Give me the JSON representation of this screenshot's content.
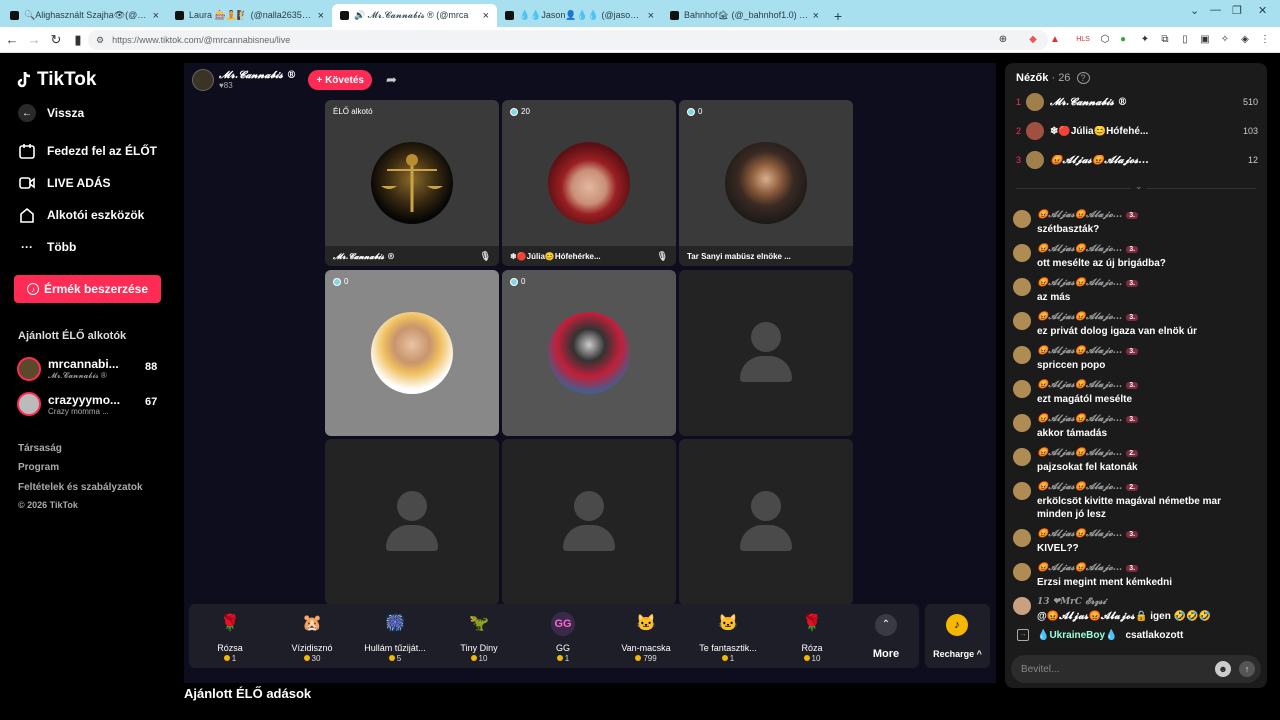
{
  "browser": {
    "tabs": [
      {
        "label": "🔍Alighasznált Szajha👁(@feherfa"
      },
      {
        "label": "Laura 🎰🧘🧗 (@nalla2635) ÉLŐ adá"
      },
      {
        "label": "🔊 𝓜𝓻.𝓒𝓪𝓷𝓷𝓪𝓫𝓲𝓼 ® (@mrca",
        "active": true
      },
      {
        "label": "💧💧Jason👤💧💧 (@jason_samara"
      },
      {
        "label": "Bahnhof🏚 (@_bahnhof1.0) ÉLŐ adá"
      }
    ],
    "new_tab": "+",
    "url": "https://www.tiktok.com/@mrcannabisneu/live"
  },
  "sidebar": {
    "logo": "TikTok",
    "nav": [
      {
        "label": "Vissza",
        "icon": "arrow-left-icon"
      },
      {
        "label": "Fedezd fel az ÉLŐT",
        "icon": "calendar-icon"
      },
      {
        "label": "LIVE ADÁS",
        "icon": "camera-icon"
      },
      {
        "label": "Alkotói eszközök",
        "icon": "home-icon"
      },
      {
        "label": "Több",
        "icon": "more-dots-icon"
      }
    ],
    "buy_button": "Érmék beszerzése",
    "recommended_title": "Ajánlott ÉLŐ alkotók",
    "recommended": [
      {
        "name": "mrcannabi...",
        "sub": "𝓜𝓻.𝓒𝓪𝓷𝓷𝓪𝓫𝓲𝓼 ®",
        "count": "88"
      },
      {
        "name": "crazyyymo...",
        "sub": "Crazy momma ...",
        "count": "67"
      }
    ],
    "footer": [
      "Társaság",
      "Program",
      "Feltételek és szabályzatok",
      "© 2026 TikTok"
    ]
  },
  "stream": {
    "host_name": "𝓜𝓻.𝓒𝓪𝓷𝓷𝓪𝓫𝓲𝓼 ®",
    "likes": "♥83",
    "follow": "+ Követés",
    "tiles": [
      {
        "top": "ÉLŐ alkotó",
        "caption": "𝓜𝓻.𝓒𝓪𝓷𝓷𝓪𝓫𝓲𝓼 ®"
      },
      {
        "top": "20",
        "caption": "❄🔴Júlia😊Hófehérke..."
      },
      {
        "top": "0",
        "caption": "Tar Sanyi mabüsz elnöke ..."
      },
      {
        "top": "0",
        "caption": ""
      },
      {
        "top": "0",
        "caption": ""
      }
    ]
  },
  "gifts": [
    {
      "name": "Rózsa",
      "price": "1",
      "icon": "🌹"
    },
    {
      "name": "Vízidisznó",
      "price": "30",
      "icon": "🐹"
    },
    {
      "name": "Hullám tűziját...",
      "price": "5",
      "icon": "🎆"
    },
    {
      "name": "Tiny Diny",
      "price": "10",
      "icon": "🦖"
    },
    {
      "name": "GG",
      "price": "1",
      "icon": "GG"
    },
    {
      "name": "Van-macska",
      "price": "799",
      "icon": "🐱"
    },
    {
      "name": "Te fantasztik...",
      "price": "1",
      "icon": "🐱"
    },
    {
      "name": "Róza",
      "price": "10",
      "icon": "🌹"
    }
  ],
  "more_label": "More",
  "recharge_label": "Recharge ^",
  "suggested_title": "Ajánlott ÉLŐ adások",
  "chat": {
    "title": "Nézők",
    "viewer_count": "· 26",
    "top_viewers": [
      {
        "rank": "1",
        "name": "𝓜𝓻.𝓒𝓪𝓷𝓷𝓪𝓫𝓲𝓼 ®",
        "score": "510"
      },
      {
        "rank": "2",
        "name": "❄🔴Júlia😊Hófehé...",
        "score": "103"
      },
      {
        "rank": "3",
        "name": "😡𝓐𝓵𝓳𝓪𝓼😡𝓐𝓵𝓪𝓳𝓸𝓼...",
        "score": "12"
      }
    ],
    "messages": [
      {
        "user": "😡𝓐𝓵𝓳𝓪𝓼😡𝓐𝓵𝓪𝓳𝓸...",
        "badge": "3.",
        "text": "szétbaszták?"
      },
      {
        "user": "😡𝓐𝓵𝓳𝓪𝓼😡𝓐𝓵𝓪𝓳𝓸...",
        "badge": "3.",
        "text": "ott mesélte az új brigádba?"
      },
      {
        "user": "😡𝓐𝓵𝓳𝓪𝓼😡𝓐𝓵𝓪𝓳𝓸...",
        "badge": "3.",
        "text": "az más"
      },
      {
        "user": "😡𝓐𝓵𝓳𝓪𝓼😡𝓐𝓵𝓪𝓳𝓸...",
        "badge": "3.",
        "text": "ez privát dolog igaza van elnök úr"
      },
      {
        "user": "😡𝓐𝓵𝓳𝓪𝓼😡𝓐𝓵𝓪𝓳𝓸...",
        "badge": "3.",
        "text": "spriccen popo"
      },
      {
        "user": "😡𝓐𝓵𝓳𝓪𝓼😡𝓐𝓵𝓪𝓳𝓸...",
        "badge": "3.",
        "text": "ezt magától mesélte"
      },
      {
        "user": "😡𝓐𝓵𝓳𝓪𝓼😡𝓐𝓵𝓪𝓳𝓸...",
        "badge": "3.",
        "text": "akkor támadás"
      },
      {
        "user": "😡𝓐𝓵𝓳𝓪𝓼😡𝓐𝓵𝓪𝓳𝓸...",
        "badge": "2.",
        "text": "pajzsokat fel katonák"
      },
      {
        "user": "😡𝓐𝓵𝓳𝓪𝓼😡𝓐𝓵𝓪𝓳𝓸...",
        "badge": "2.",
        "text": "erkölcsöt kivitte magával németbe mar minden jó lesz"
      },
      {
        "user": "😡𝓐𝓵𝓳𝓪𝓼😡𝓐𝓵𝓪𝓳𝓸...",
        "badge": "3.",
        "text": "KIVEL??"
      },
      {
        "user": "😡𝓐𝓵𝓳𝓪𝓼😡𝓐𝓵𝓪𝓳𝓸...",
        "badge": "3.",
        "text": "Erzsi megint ment kémkedni"
      },
      {
        "user": "13 ❤MrC 𝓔𝓻𝔃𝓼𝓲",
        "badge": "",
        "text": "@😡𝓐𝓵𝓳𝓪𝓼😡𝓐𝓵𝓪𝓳𝓸𝓼🔒 igen 🤣🤣🤣"
      }
    ],
    "join_user": "💧UkraineBoy💧",
    "join_text": "csatlakozott",
    "input_placeholder": "Bevitel..."
  }
}
